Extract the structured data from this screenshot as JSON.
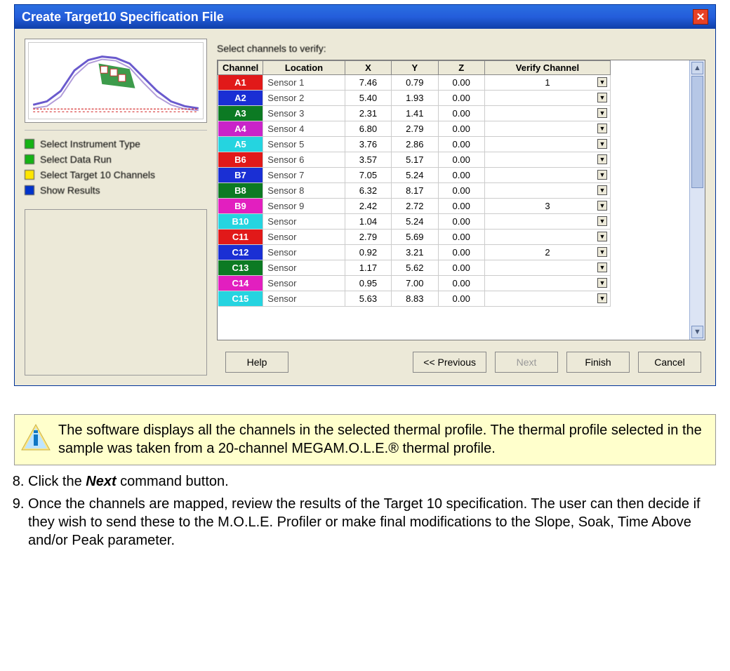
{
  "window": {
    "title": "Create Target10 Specification File"
  },
  "sidebar": {
    "steps": [
      {
        "label": "Select Instrument Type",
        "state": "green"
      },
      {
        "label": "Select Data Run",
        "state": "green"
      },
      {
        "label": "Select Target 10 Channels",
        "state": "yellow"
      },
      {
        "label": "Show Results",
        "state": "blue"
      }
    ]
  },
  "main": {
    "prompt": "Select channels to verify:",
    "headers": [
      "Channel",
      "Location",
      "X",
      "Y",
      "Z",
      "Verify Channel"
    ],
    "rows": [
      {
        "ch": "A1",
        "color": "#e11919",
        "loc": "Sensor 1",
        "x": "7.46",
        "y": "0.79",
        "z": "0.00",
        "verify": "1"
      },
      {
        "ch": "A2",
        "color": "#1a2fd4",
        "loc": "Sensor 2",
        "x": "5.40",
        "y": "1.93",
        "z": "0.00",
        "verify": ""
      },
      {
        "ch": "A3",
        "color": "#0c7a23",
        "loc": "Sensor 3",
        "x": "2.31",
        "y": "1.41",
        "z": "0.00",
        "verify": ""
      },
      {
        "ch": "A4",
        "color": "#c924c9",
        "loc": "Sensor 4",
        "x": "6.80",
        "y": "2.79",
        "z": "0.00",
        "verify": ""
      },
      {
        "ch": "A5",
        "color": "#25d4e0",
        "loc": "Sensor 5",
        "x": "3.76",
        "y": "2.86",
        "z": "0.00",
        "verify": ""
      },
      {
        "ch": "B6",
        "color": "#e11919",
        "loc": "Sensor 6",
        "x": "3.57",
        "y": "5.17",
        "z": "0.00",
        "verify": ""
      },
      {
        "ch": "B7",
        "color": "#1a2fd4",
        "loc": "Sensor 7",
        "x": "7.05",
        "y": "5.24",
        "z": "0.00",
        "verify": ""
      },
      {
        "ch": "B8",
        "color": "#0c7a23",
        "loc": "Sensor 8",
        "x": "6.32",
        "y": "8.17",
        "z": "0.00",
        "verify": ""
      },
      {
        "ch": "B9",
        "color": "#e21fbf",
        "loc": "Sensor 9",
        "x": "2.42",
        "y": "2.72",
        "z": "0.00",
        "verify": "3"
      },
      {
        "ch": "B10",
        "color": "#25d4e0",
        "loc": "Sensor",
        "x": "1.04",
        "y": "5.24",
        "z": "0.00",
        "verify": ""
      },
      {
        "ch": "C11",
        "color": "#e11919",
        "loc": "Sensor",
        "x": "2.79",
        "y": "5.69",
        "z": "0.00",
        "verify": ""
      },
      {
        "ch": "C12",
        "color": "#1a2fd4",
        "loc": "Sensor",
        "x": "0.92",
        "y": "3.21",
        "z": "0.00",
        "verify": "2"
      },
      {
        "ch": "C13",
        "color": "#0c7a23",
        "loc": "Sensor",
        "x": "1.17",
        "y": "5.62",
        "z": "0.00",
        "verify": ""
      },
      {
        "ch": "C14",
        "color": "#e21fbf",
        "loc": "Sensor",
        "x": "0.95",
        "y": "7.00",
        "z": "0.00",
        "verify": ""
      },
      {
        "ch": "C15",
        "color": "#25d4e0",
        "loc": "Sensor",
        "x": "5.63",
        "y": "8.83",
        "z": "0.00",
        "verify": ""
      }
    ]
  },
  "buttons": {
    "help": "Help",
    "prev": "<< Previous",
    "next": "Next",
    "finish": "Finish",
    "cancel": "Cancel"
  },
  "note": {
    "text": "The software displays all the channels in the selected thermal profile. The thermal profile   selected in the sample was taken from a 20-channel MEGAM.O.L.E.® thermal profile."
  },
  "instructions": {
    "step8_prefix": "Click the ",
    "step8_bold": "Next",
    "step8_suffix": " command button.",
    "step9": "Once the channels are mapped, review the results of the Target 10 specification. The user can then decide if they wish to send these to the M.O.L.E. Profiler or make final modifications to the Slope, Soak, Time Above and/or Peak parameter."
  }
}
